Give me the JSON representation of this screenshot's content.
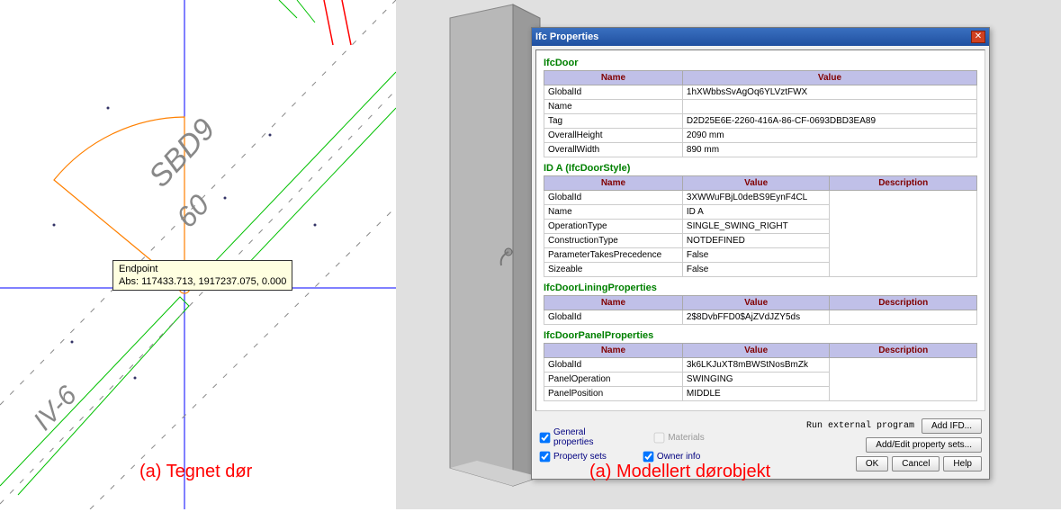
{
  "cad": {
    "tooltip_title": "Endpoint",
    "tooltip_coords": "Abs: 117433.713, 1917237.075, 0.000",
    "label_sbd9": "SBD9",
    "label_60": "60",
    "label_iv6": "IV-6"
  },
  "captions": {
    "left": "(a) Tegnet dør",
    "right": "(a) Modellert dørobjekt"
  },
  "dialog": {
    "title": "Ifc Properties",
    "sections": {
      "ifcDoor": {
        "heading": "IfcDoor",
        "headers": [
          "Name",
          "Value"
        ],
        "rows": [
          [
            "GlobalId",
            "1hXWbbsSvAgOq6YLVztFWX"
          ],
          [
            "Name",
            ""
          ],
          [
            "Tag",
            "D2D25E6E-2260-416A-86-CF-0693DBD3EA89"
          ],
          [
            "OverallHeight",
            "2090 mm"
          ],
          [
            "OverallWidth",
            "890 mm"
          ]
        ]
      },
      "ifcDoorStyle": {
        "heading": "ID A (IfcDoorStyle)",
        "headers": [
          "Name",
          "Value",
          "Description"
        ],
        "rows": [
          [
            "GlobalId",
            "3XWWuFBjL0deBS9EynF4CL",
            ""
          ],
          [
            "Name",
            "ID A",
            ""
          ],
          [
            "OperationType",
            "SINGLE_SWING_RIGHT",
            ""
          ],
          [
            "ConstructionType",
            "NOTDEFINED",
            ""
          ],
          [
            "ParameterTakesPrecedence",
            "False",
            ""
          ],
          [
            "Sizeable",
            "False",
            ""
          ]
        ]
      },
      "ifcDoorLining": {
        "heading": "IfcDoorLiningProperties",
        "headers": [
          "Name",
          "Value",
          "Description"
        ],
        "rows": [
          [
            "GlobalId",
            "2$8DvbFFD0$AjZVdJZY5ds",
            ""
          ]
        ]
      },
      "ifcDoorPanel": {
        "heading": "IfcDoorPanelProperties",
        "headers": [
          "Name",
          "Value",
          "Description"
        ],
        "rows": [
          [
            "GlobalId",
            "3k6LKJuXT8mBWStNosBmZk",
            ""
          ],
          [
            "PanelOperation",
            "SWINGING",
            ""
          ],
          [
            "PanelPosition",
            "MIDDLE",
            ""
          ]
        ]
      }
    },
    "footer": {
      "general_properties": "General properties",
      "property_sets": "Property sets",
      "materials": "Materials",
      "owner_info": "Owner info",
      "run_external": "Run external program",
      "add_ifd": "Add IFD...",
      "add_edit_property": "Add/Edit property sets...",
      "ok": "OK",
      "cancel": "Cancel",
      "help": "Help"
    }
  }
}
